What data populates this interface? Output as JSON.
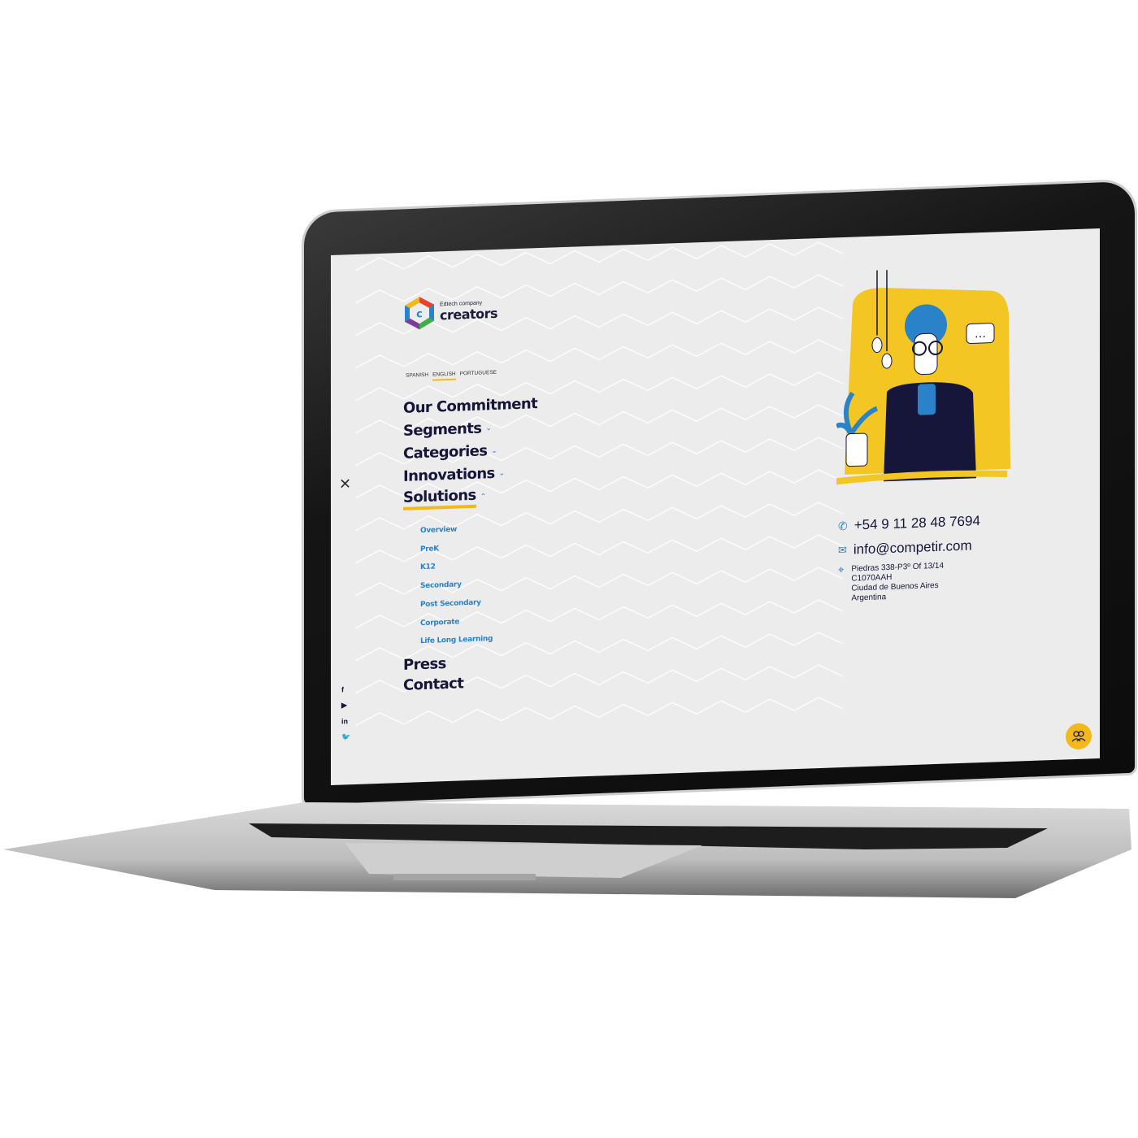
{
  "brand": {
    "tagline": "Edtech company",
    "name": "creators",
    "colors": {
      "navy": "#15163a",
      "yellow": "#f3b81b",
      "blue": "#2a83c8"
    }
  },
  "languages": [
    {
      "label": "SPANISH",
      "active": false
    },
    {
      "label": "ENGLISH",
      "active": true
    },
    {
      "label": "PORTUGUESE",
      "active": false
    }
  ],
  "nav": {
    "items": [
      {
        "label": "Our Commitment",
        "chevron": ""
      },
      {
        "label": "Segments",
        "chevron": "⌄"
      },
      {
        "label": "Categories",
        "chevron": "⌄"
      },
      {
        "label": "Innovations",
        "chevron": "⌄"
      },
      {
        "label": "Solutions",
        "chevron": "⌃"
      }
    ],
    "solutions_sub": [
      "Overview",
      "PreK",
      "K12",
      "Secondary",
      "Post Secondary",
      "Corporate",
      "Life Long Learning"
    ],
    "bottom_items": [
      "Press",
      "Contact"
    ]
  },
  "close_icon": "close-icon",
  "social": {
    "icons": [
      "facebook-icon",
      "youtube-icon",
      "linkedin-icon",
      "twitter-icon"
    ],
    "glyphs": [
      "f",
      "▶",
      "in",
      "🐦"
    ]
  },
  "contact": {
    "phone": "+54 9 11 28 48 7694",
    "email": "info@competir.com",
    "address": [
      "Piedras 338-P3º Of 13/14",
      "C1070AAH",
      "Ciudad de Buenos Aires",
      "Argentina"
    ]
  },
  "fab_icon": "users-icon"
}
